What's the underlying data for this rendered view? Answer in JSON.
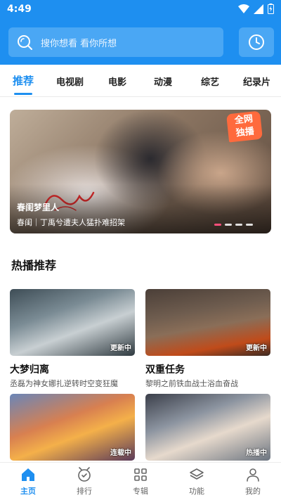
{
  "status": {
    "time": "4:49"
  },
  "search": {
    "placeholder": "搜你想看 看你所想"
  },
  "tabs": [
    {
      "label": "推荐",
      "active": true
    },
    {
      "label": "电视剧"
    },
    {
      "label": "电影"
    },
    {
      "label": "动漫"
    },
    {
      "label": "综艺"
    },
    {
      "label": "纪录片"
    }
  ],
  "banner": {
    "badge_line1": "全网",
    "badge_line2": "独播",
    "title": "春闺梦里人",
    "subtitle": "春闺｜丁禹兮遭夫人猛扑难招架",
    "page_count": 4,
    "active_page": 1
  },
  "section": {
    "title": "热播推荐"
  },
  "cards": [
    {
      "name": "大梦归离",
      "desc": "丞磊为神女娜扎逆转时空变狂魔",
      "tag": "更新中"
    },
    {
      "name": "双重任务",
      "desc": "黎明之前铁血战士浴血奋战",
      "tag": "更新中"
    },
    {
      "name": "",
      "desc": "",
      "tag": "连载中"
    },
    {
      "name": "",
      "desc": "",
      "tag": "热播中"
    }
  ],
  "bottom_nav": [
    {
      "label": "主页",
      "icon": "home-icon",
      "active": true
    },
    {
      "label": "排行",
      "icon": "ranking-icon"
    },
    {
      "label": "专辑",
      "icon": "album-grid-icon"
    },
    {
      "label": "功能",
      "icon": "layers-icon"
    },
    {
      "label": "我的",
      "icon": "user-icon"
    }
  ],
  "colors": {
    "accent": "#1e8ff0",
    "badge": "#ff6a3d",
    "dot_active": "#ff4f7b"
  }
}
